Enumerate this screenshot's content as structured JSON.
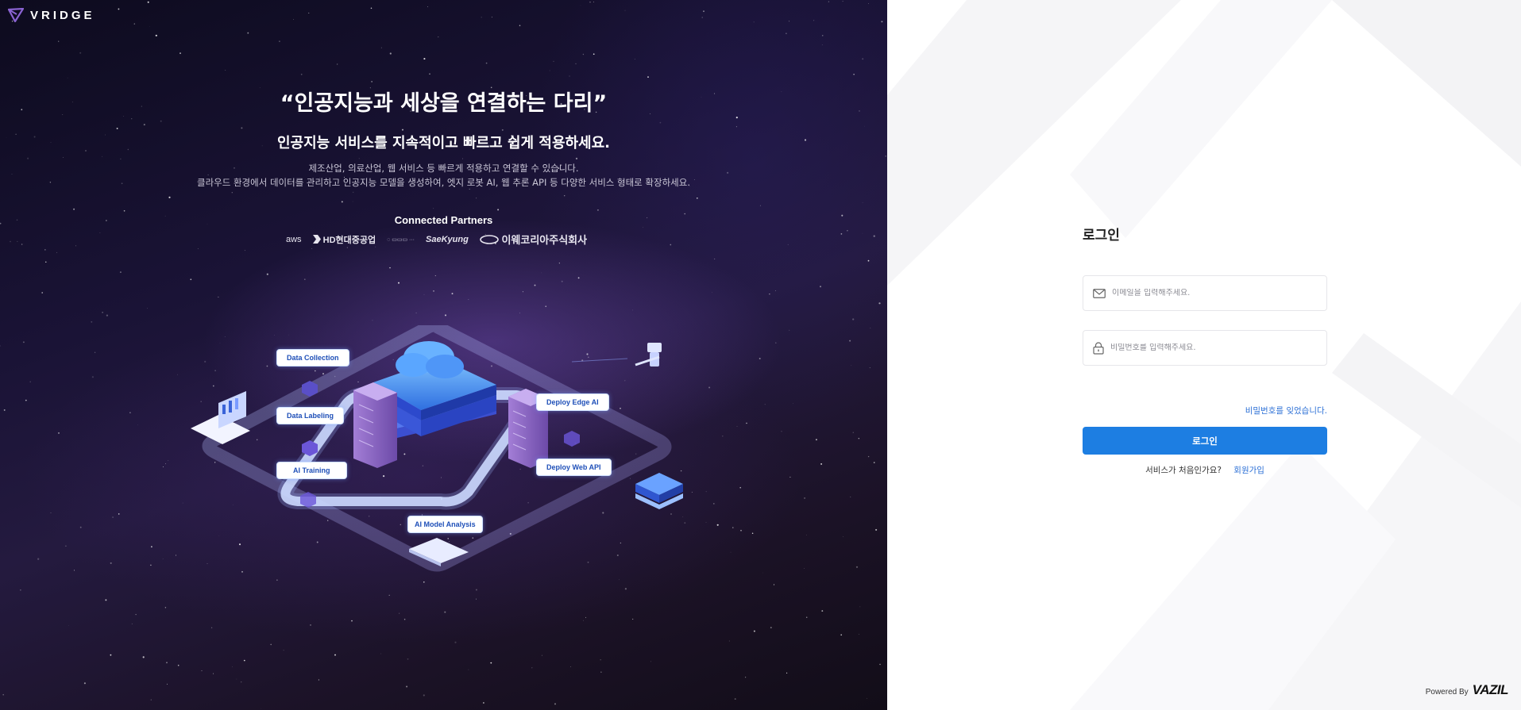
{
  "brand": {
    "name": "VRIDGE",
    "accent": "#8a63d2"
  },
  "hero": {
    "quote": "“인공지능과 세상을 연결하는 다리”",
    "subtitle": "인공지능 서비스를 지속적이고 빠르고 쉽게 적용하세요.",
    "desc_line1": "제조산업, 의료산업, 웹 서비스 등 빠르게 적용하고 연결할 수 있습니다.",
    "desc_line2": "클라우드 환경에서 데이터를 관리하고 인공지능 모델을 생성하여, 엣지 로봇 AI, 웹 추론 API 등 다양한 서비스 형태로 확장하세요."
  },
  "partners": {
    "title": "Connected Partners",
    "items": [
      "aws",
      "HD현대중공업",
      "SaeKyung",
      "이웨코리아주식회사"
    ]
  },
  "diagram": {
    "data_collection": "Data Collection",
    "data_labeling": "Data Labeling",
    "ai_training": "AI Training",
    "deploy_edge": "Deploy Edge AI",
    "deploy_web": "Deploy Web API",
    "model_analysis": "AI Model Analysis"
  },
  "login": {
    "title": "로그인",
    "email_placeholder": "이메일을 입력해주세요.",
    "password_placeholder": "비밀번호를 입력해주세요.",
    "forgot_label": "비밀번호를 잊었습니다.",
    "submit_label": "로그인",
    "signup_prompt": "서비스가 처음인가요?",
    "signup_link": "회원가입",
    "accent": "#1d7ee2"
  },
  "footer": {
    "powered_label": "Powered By",
    "powered_brand": "VAZIL"
  }
}
